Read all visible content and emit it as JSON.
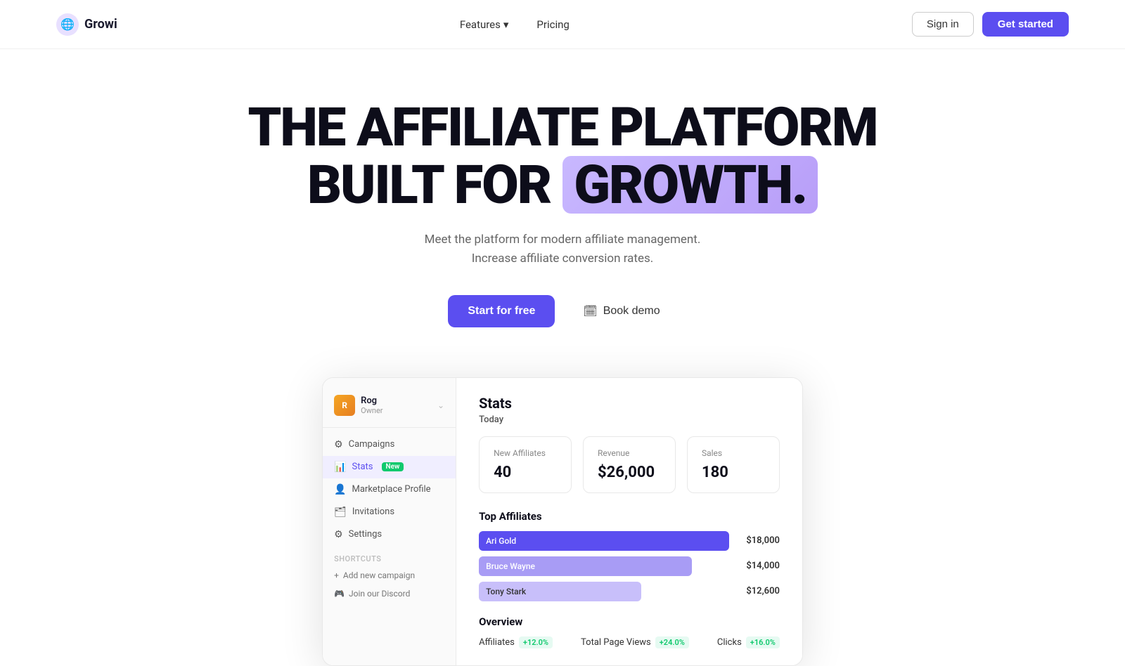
{
  "nav": {
    "logo_text": "Growi",
    "features_label": "Features",
    "pricing_label": "Pricing",
    "signin_label": "Sign in",
    "getstarted_label": "Get started"
  },
  "hero": {
    "line1": "THE AFFILIATE PLATFORM",
    "line2_prefix": "BUILT FOR ",
    "line2_highlight": "GROWTH.",
    "subtitle_line1": "Meet the platform for modern affiliate management.",
    "subtitle_line2": "Increase affiliate conversion rates.",
    "cta_start": "Start for free",
    "cta_demo": "Book demo"
  },
  "dashboard": {
    "user": {
      "name": "Rog",
      "role": "Owner",
      "avatar_initials": "R"
    },
    "sidebar_items": [
      {
        "label": "Campaigns",
        "icon": "⚙",
        "active": false
      },
      {
        "label": "Stats",
        "icon": "📊",
        "active": true,
        "badge": "New"
      },
      {
        "label": "Marketplace Profile",
        "icon": "👤",
        "active": false
      },
      {
        "label": "Invitations",
        "icon": "🗂",
        "active": false
      },
      {
        "label": "Settings",
        "icon": "⚙",
        "active": false
      }
    ],
    "shortcuts_label": "Shortcuts",
    "shortcuts": [
      {
        "label": "Add new campaign",
        "icon": "+"
      },
      {
        "label": "Join our Discord",
        "icon": "🎮"
      }
    ],
    "stats": {
      "title": "Stats",
      "today_label": "Today",
      "cards": [
        {
          "label": "New Affiliates",
          "value": "40"
        },
        {
          "label": "Revenue",
          "value": "$26,000"
        },
        {
          "label": "Sales",
          "value": "180"
        }
      ]
    },
    "top_affiliates": {
      "title": "Top Affiliates",
      "items": [
        {
          "name": "Ari Gold",
          "amount": "$18,000",
          "width": "100%"
        },
        {
          "name": "Bruce Wayne",
          "amount": "$14,000",
          "width": "85%"
        },
        {
          "name": "Tony Stark",
          "amount": "$12,600",
          "width": "65%"
        }
      ]
    },
    "overview": {
      "title": "Overview",
      "items": [
        {
          "label": "Affiliates",
          "badge": "+12.0%",
          "badge_color": "green"
        },
        {
          "label": "Total Page Views",
          "badge": "+24.0%",
          "badge_color": "green"
        },
        {
          "label": "Clicks",
          "badge": "+16.0%",
          "badge_color": "green"
        }
      ]
    }
  }
}
